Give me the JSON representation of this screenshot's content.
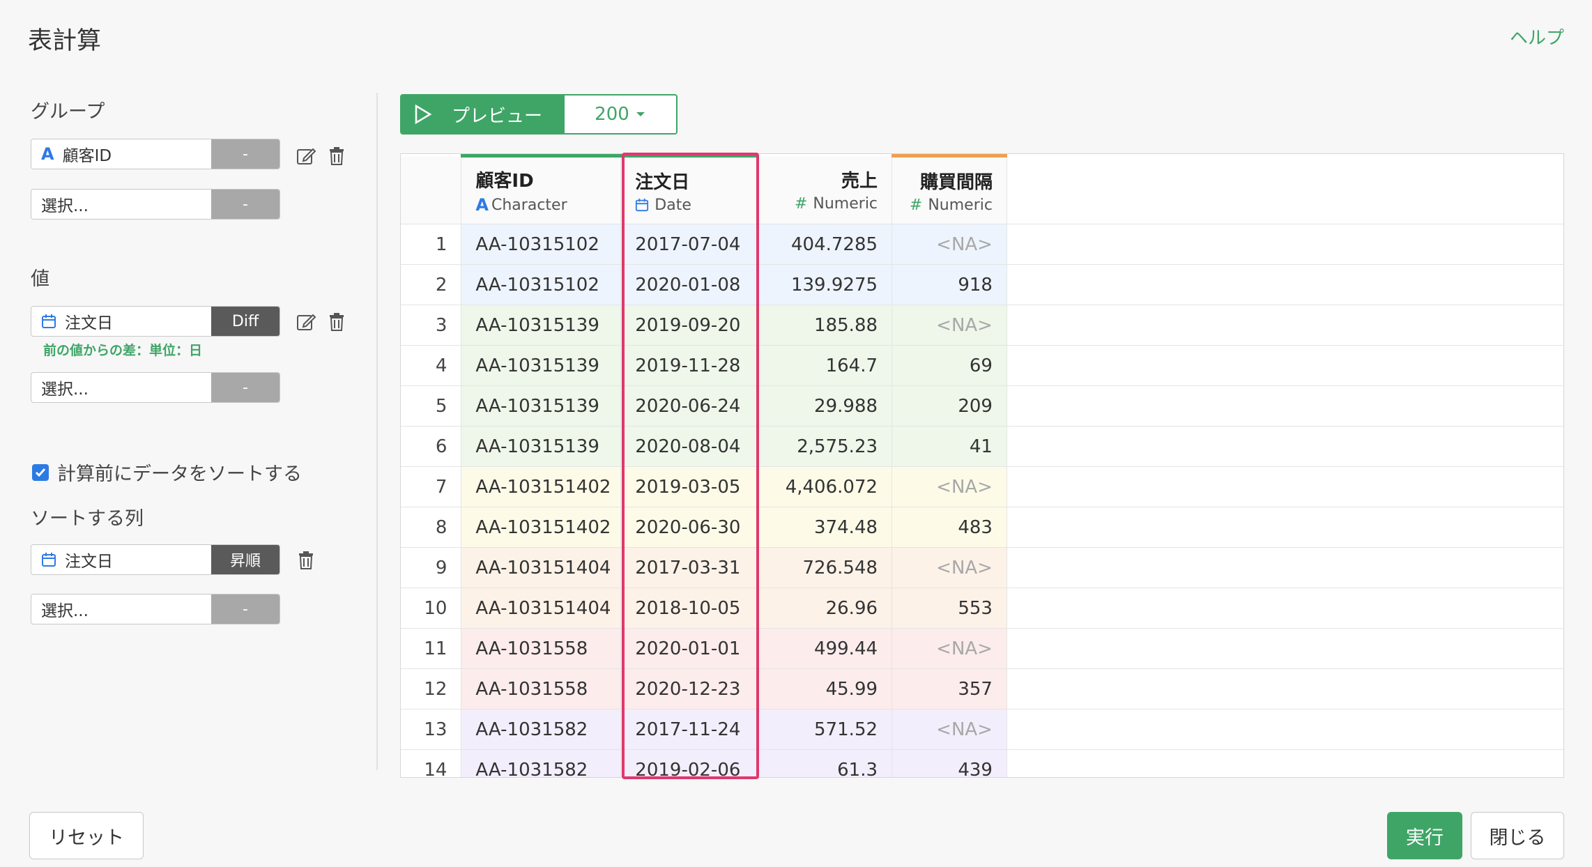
{
  "dialog": {
    "title": "表計算",
    "help_label": "ヘルプ"
  },
  "group": {
    "label": "グループ",
    "selectors": [
      {
        "field": "顧客ID",
        "op": "-",
        "type_icon": "character-icon"
      },
      {
        "field": "選択...",
        "op": "-"
      }
    ]
  },
  "value": {
    "label": "値",
    "selectors": [
      {
        "field": "注文日",
        "op": "Diff",
        "type_icon": "calendar-icon"
      },
      {
        "field": "選択...",
        "op": "-"
      }
    ],
    "note": "前の値からの差：単位：日"
  },
  "sort": {
    "checkbox_label": "計算前にデータをソートする",
    "checked": true,
    "columns_label": "ソートする列",
    "selectors": [
      {
        "field": "注文日",
        "op": "昇順",
        "type_icon": "calendar-icon"
      },
      {
        "field": "選択...",
        "op": "-"
      }
    ]
  },
  "preview": {
    "button_label": "プレビュー",
    "count": "200"
  },
  "table": {
    "columns": [
      {
        "name": "顧客ID",
        "type": "Character",
        "bar_color": "#3fa567"
      },
      {
        "name": "注文日",
        "type": "Date",
        "bar_color": "#3fa567"
      },
      {
        "name": "売上",
        "type": "Numeric"
      },
      {
        "name": "購買間隔",
        "type": "Numeric",
        "bar_color": "#f0a050"
      }
    ],
    "rows": [
      {
        "idx": "1",
        "id": "AA-10315102",
        "date": "2017-07-04",
        "sales": "404.7285",
        "interval": "<NA>",
        "bg": "#eef4fd"
      },
      {
        "idx": "2",
        "id": "AA-10315102",
        "date": "2020-01-08",
        "sales": "139.9275",
        "interval": "918",
        "bg": "#eef4fd"
      },
      {
        "idx": "3",
        "id": "AA-10315139",
        "date": "2019-09-20",
        "sales": "185.88",
        "interval": "<NA>",
        "bg": "#eef7ea"
      },
      {
        "idx": "4",
        "id": "AA-10315139",
        "date": "2019-11-28",
        "sales": "164.7",
        "interval": "69",
        "bg": "#eef7ea"
      },
      {
        "idx": "5",
        "id": "AA-10315139",
        "date": "2020-06-24",
        "sales": "29.988",
        "interval": "209",
        "bg": "#eef7ea"
      },
      {
        "idx": "6",
        "id": "AA-10315139",
        "date": "2020-08-04",
        "sales": "2,575.23",
        "interval": "41",
        "bg": "#eef7ea"
      },
      {
        "idx": "7",
        "id": "AA-103151402",
        "date": "2019-03-05",
        "sales": "4,406.072",
        "interval": "<NA>",
        "bg": "#fdfbe8"
      },
      {
        "idx": "8",
        "id": "AA-103151402",
        "date": "2020-06-30",
        "sales": "374.48",
        "interval": "483",
        "bg": "#fdfbe8"
      },
      {
        "idx": "9",
        "id": "AA-103151404",
        "date": "2017-03-31",
        "sales": "726.548",
        "interval": "<NA>",
        "bg": "#fdf2e8"
      },
      {
        "idx": "10",
        "id": "AA-103151404",
        "date": "2018-10-05",
        "sales": "26.96",
        "interval": "553",
        "bg": "#fdf2e8"
      },
      {
        "idx": "11",
        "id": "AA-1031558",
        "date": "2020-01-01",
        "sales": "499.44",
        "interval": "<NA>",
        "bg": "#fdecec"
      },
      {
        "idx": "12",
        "id": "AA-1031558",
        "date": "2020-12-23",
        "sales": "45.99",
        "interval": "357",
        "bg": "#fdecec"
      },
      {
        "idx": "13",
        "id": "AA-1031582",
        "date": "2017-11-24",
        "sales": "571.52",
        "interval": "<NA>",
        "bg": "#f3eefc"
      },
      {
        "idx": "14",
        "id": "AA-1031582",
        "date": "2019-02-06",
        "sales": "61.3",
        "interval": "439",
        "bg": "#f3eefc"
      }
    ]
  },
  "footer": {
    "reset_label": "リセット",
    "run_label": "実行",
    "close_label": "閉じる"
  },
  "colors": {
    "accent": "#3fa567",
    "highlight": "#e0386c",
    "op_gray": "#a8a8a8",
    "op_dark": "#5a5a5a"
  }
}
